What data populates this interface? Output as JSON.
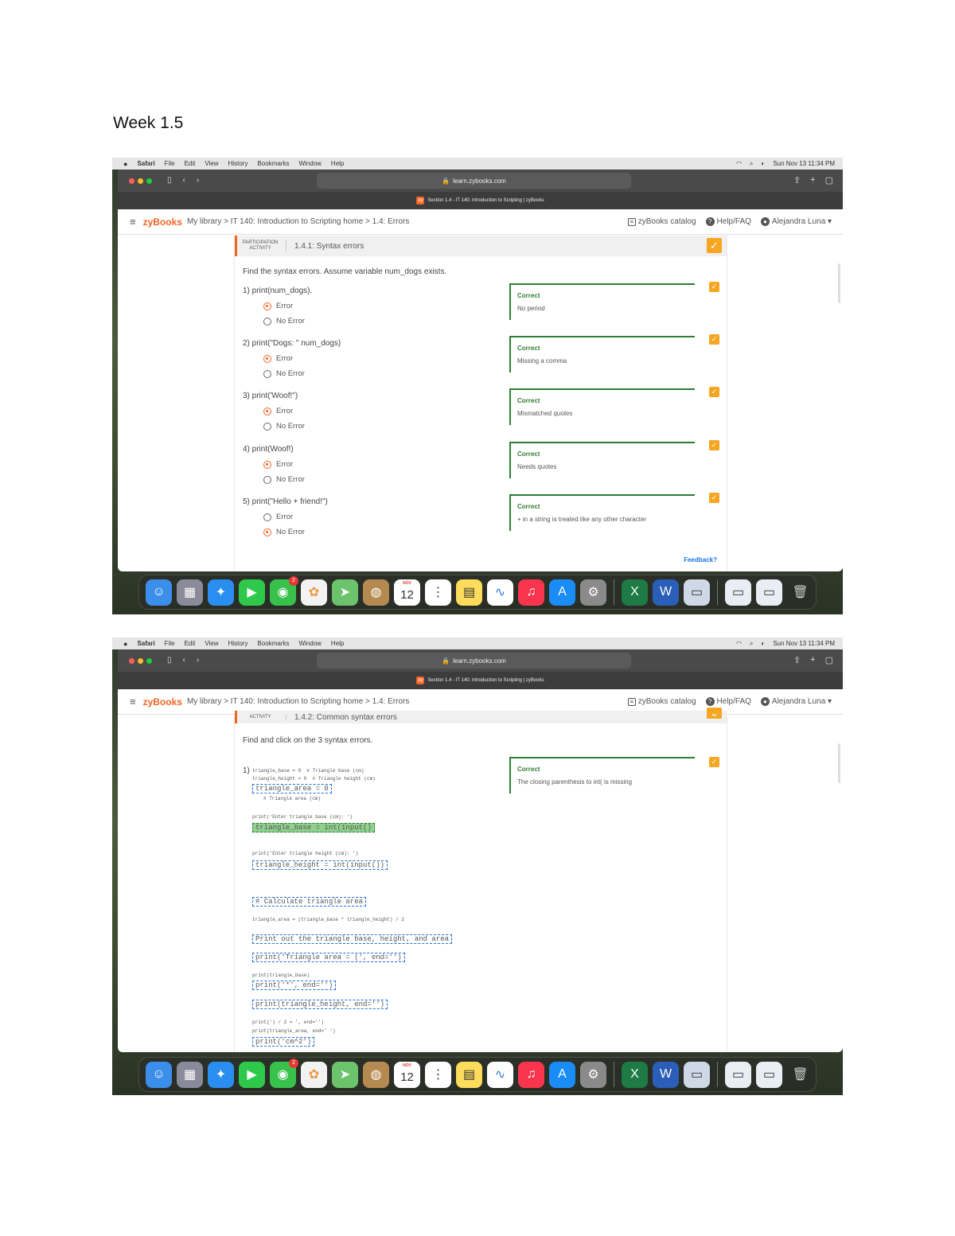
{
  "document": {
    "heading": "Week 1.5"
  },
  "menubar": {
    "apple": "",
    "app": "Safari",
    "items": [
      "File",
      "Edit",
      "View",
      "History",
      "Bookmarks",
      "Window",
      "Help"
    ],
    "datetime": "Sun Nov 13 11:34 PM"
  },
  "browser": {
    "url": "learn.zybooks.com",
    "tab_title": "Section 1.4 - IT 140: Introduction to Scripting | zyBooks",
    "tab_favicon": "zy"
  },
  "zyheader": {
    "logo": "zyBooks",
    "breadcrumb": "My library > IT 140: Introduction to Scripting home > 1.4: Errors",
    "catalog": "zyBooks catalog",
    "help": "Help/FAQ",
    "user": "Alejandra Luna"
  },
  "shot1": {
    "activity_label": "PARTICIPATION ACTIVITY",
    "activity_title": "1.4.1: Syntax errors",
    "instructions": "Find the syntax errors. Assume variable num_dogs exists.",
    "options": [
      "Error",
      "No Error"
    ],
    "questions": [
      {
        "text": "1)  print(num_dogs).",
        "selected": 0,
        "status": "Correct",
        "message": "No period"
      },
      {
        "text": "2)  print(\"Dogs: \" num_dogs)",
        "selected": 0,
        "status": "Correct",
        "message": "Missing a comma"
      },
      {
        "text": "3)  print('Woof!\")",
        "selected": 0,
        "status": "Correct",
        "message": "Mismatched quotes"
      },
      {
        "text": "4)  print(Woof!)",
        "selected": 0,
        "status": "Correct",
        "message": "Needs quotes"
      },
      {
        "text": "5)  print(\"Hello + friend!\")",
        "selected": 1,
        "status": "Correct",
        "message": "+ in a string is treated like any other character"
      }
    ],
    "feedback": "Feedback?"
  },
  "shot2": {
    "activity_label": "ACTIVITY",
    "activity_title": "1.4.2: Common syntax errors",
    "instructions": "Find and click on the 3 syntax errors.",
    "qnum": "1)",
    "status": "Correct",
    "message": "The closing parenthesis to int( is missing",
    "code": {
      "l1": "triangle_base = 0  # Triangle base (cm)",
      "l2": "triangle_height = 0  # Triangle height (cm)",
      "l3": "triangle_area = 0",
      "l4": "# Triangle area (cm)",
      "l5": "print('Enter triangle base (cm): ')",
      "l6": "triangle_base = int(input()",
      "l7": "print('Enter triangle height (cm): ')",
      "l8": "triangle_height = int(input())",
      "l9": "# Calculate triangle area",
      "l10": "triangle_area = (triangle_base * triangle_height) / 2",
      "l11": "Print out the triangle base, height, and area",
      "l12": "print('Triangle area = (', end='')",
      "l13": "print(triangle_base)",
      "l14": "print('*', end='')",
      "l15": "print(triangle_height, end='')",
      "l16": "print(') / 2 = ', end='')",
      "l17": "print(triangle_area, end=' ')",
      "l18": "print('cm^2')"
    }
  },
  "dock": {
    "calendar_month": "NOV",
    "calendar_day": "12",
    "messages_badge": "2",
    "apps": [
      "finder-icon",
      "launchpad-icon",
      "safari-icon",
      "facetime-icon",
      "messages-icon",
      "photos-icon",
      "maps-icon",
      "contacts-icon",
      "calendar-icon",
      "reminders-icon",
      "notes-icon",
      "freeform-icon",
      "music-icon",
      "app-store-icon",
      "system-settings-icon",
      "excel-icon",
      "word-icon",
      "preview-icon",
      "screenshot-icon",
      "screenshot-icon",
      "trash-icon"
    ]
  },
  "colors": {
    "brand": "#f26522",
    "correct": "#2e7d32",
    "check": "#f5a623",
    "link": "#1a73e8"
  }
}
